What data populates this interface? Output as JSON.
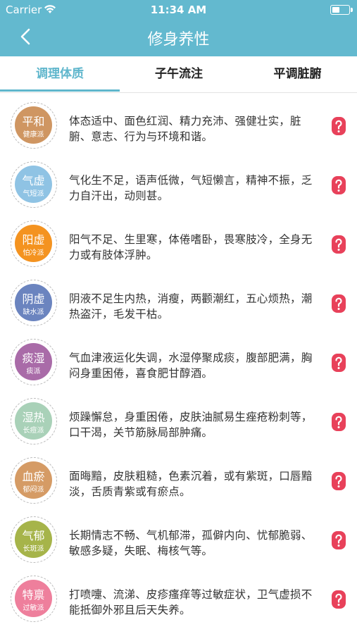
{
  "status": {
    "carrier": "Carrier",
    "time": "11:34 AM"
  },
  "header": {
    "title": "修身养性"
  },
  "tabs": [
    {
      "label": "调理体质"
    },
    {
      "label": "子午流注"
    },
    {
      "label": "平调脏腑"
    }
  ],
  "colors": {
    "header": "#63b9cf",
    "accent": "#5fb6cc",
    "help_icon": "#e8415a"
  },
  "items": [
    {
      "title": "平和",
      "sub": "健康派",
      "color": "#cf9662",
      "desc": "体态适中、面色红润、精力充沛、强健壮实，脏腑、意志、行为与环境和谐。"
    },
    {
      "title": "气虚",
      "sub": "气短派",
      "color": "#8fc3e4",
      "desc": "气化生不足，语声低微，气短懒言，精神不振，乏力自汗出，动则甚。"
    },
    {
      "title": "阳虚",
      "sub": "怕冷派",
      "color": "#f49320",
      "desc": "阳气不足、生里寒，体倦嗜卧，畏寒肢冷，全身无力或有肢体浮肿。"
    },
    {
      "title": "阴虚",
      "sub": "缺水派",
      "color": "#6b84bf",
      "desc": "阴液不足生内热，消瘦，两颧潮红，五心烦热，潮热盗汗，毛发干枯。"
    },
    {
      "title": "痰湿",
      "sub": "痰派",
      "color": "#a96ba8",
      "desc": "气血津液运化失调，水湿停聚成痰，腹部肥满，胸闷身重困倦，喜食肥甘醇酒。"
    },
    {
      "title": "湿热",
      "sub": "长痘派",
      "color": "#a9d1b8",
      "desc": "烦躁懈怠，身重困倦，皮肤油腻易生痤疮粉刺等，口干渴，关节筋脉局部肿痛。"
    },
    {
      "title": "血瘀",
      "sub": "郁闷派",
      "color": "#d59b65",
      "desc": "面晦黯，皮肤粗糙，色素沉着，或有紫斑，口唇黯淡，舌质青紫或有瘀点。"
    },
    {
      "title": "气郁",
      "sub": "长斑派",
      "color": "#a6b44a",
      "desc": "长期情志不畅、气机郁滞，孤僻内向、忧郁脆弱、敏感多疑，失眠、梅核气等。"
    },
    {
      "title": "特禀",
      "sub": "过敏派",
      "color": "#ee7f9c",
      "desc": "打喷嚏、流涕、皮疹瘙痒等过敏症状，卫气虚损不能抵御外邪且后天失养。"
    }
  ]
}
